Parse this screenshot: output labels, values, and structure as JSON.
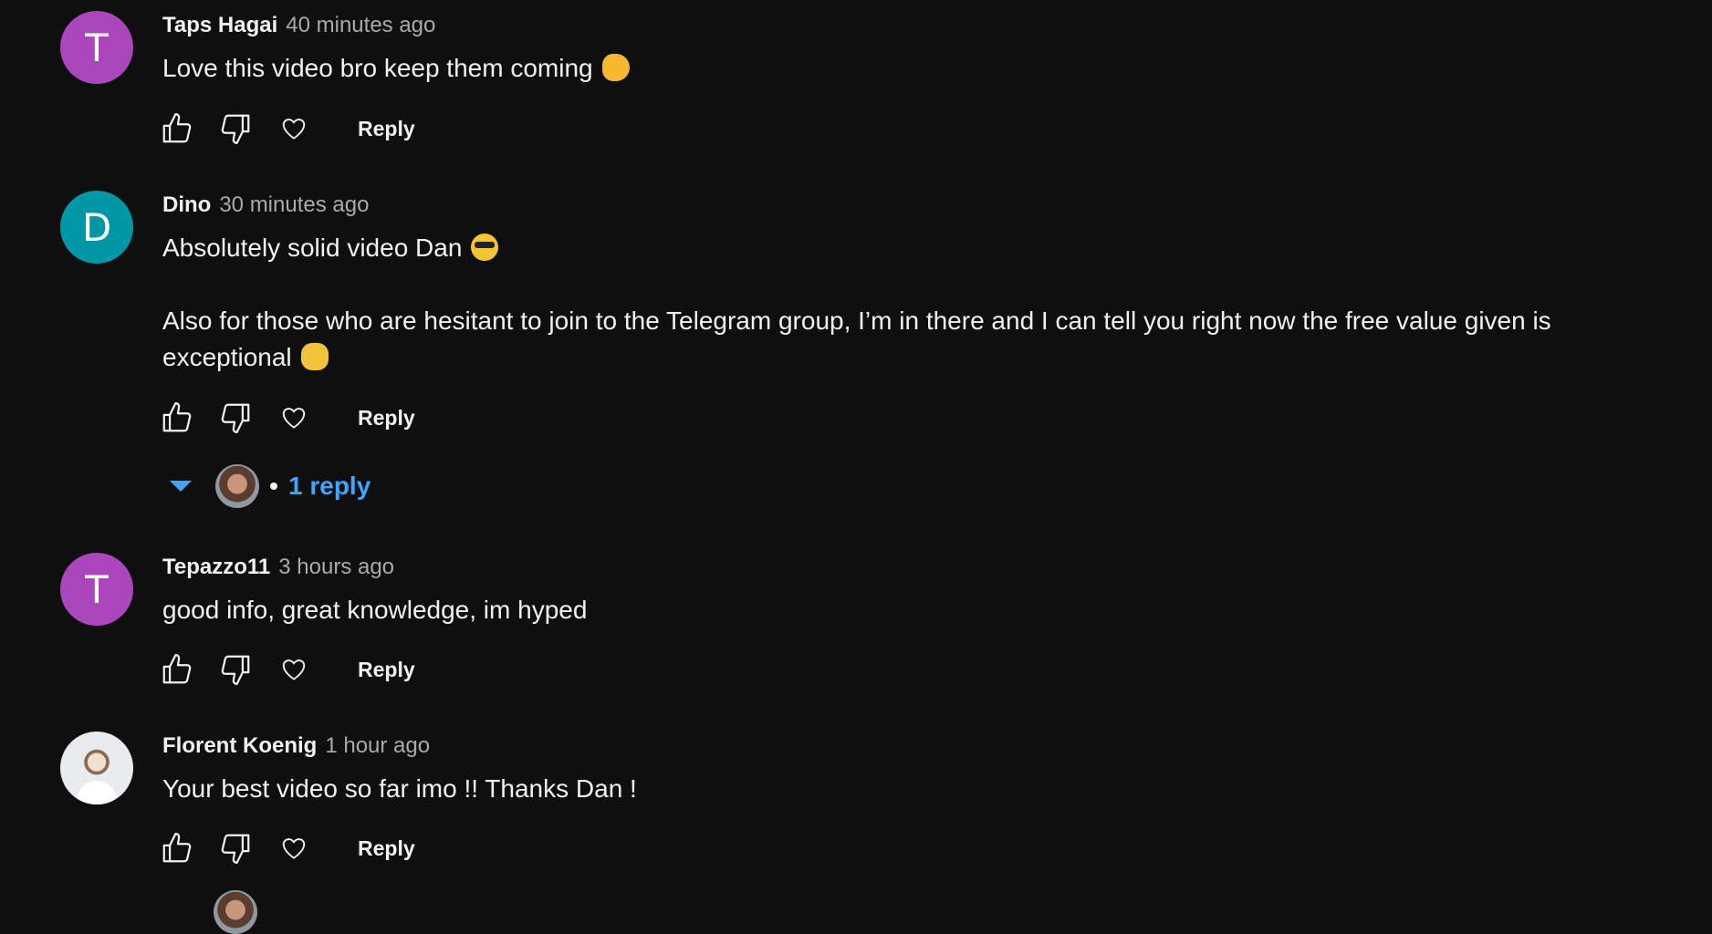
{
  "comments": [
    {
      "author": "Taps Hagai",
      "time": "40 minutes ago",
      "avatar_letter": "T",
      "avatar_color": "#ab47bc",
      "text": "Love this video bro keep them coming",
      "emoji": "ok-hand",
      "reply_label": "Reply"
    },
    {
      "author": "Dino",
      "time": "30 minutes ago",
      "avatar_letter": "D",
      "avatar_color": "#0097a7",
      "text_line1": "Absolutely solid video Dan",
      "emoji1": "sunglasses-face",
      "text_line2": "Also for those who are hesitant to join to the Telegram group, I’m in there and I can tell you right now the free value given is exceptional",
      "emoji2": "handshake",
      "reply_label": "Reply",
      "replies_label": "1 reply"
    },
    {
      "author": "Tepazzo11",
      "time": "3 hours ago",
      "avatar_letter": "T",
      "avatar_color": "#ab47bc",
      "text": "good info, great knowledge, im hyped",
      "reply_label": "Reply"
    },
    {
      "author": "Florent Koenig",
      "time": "1 hour ago",
      "avatar_type": "photo",
      "text": "Your best video so far imo !! Thanks Dan !",
      "reply_label": "Reply"
    }
  ],
  "colors": {
    "background": "#0f0f0f",
    "text": "#f1f1f1",
    "secondary_text": "#aaaaaa",
    "link_blue": "#3ea6ff"
  },
  "icons": [
    "like-icon",
    "dislike-icon",
    "heart-icon",
    "caret-down-icon"
  ]
}
